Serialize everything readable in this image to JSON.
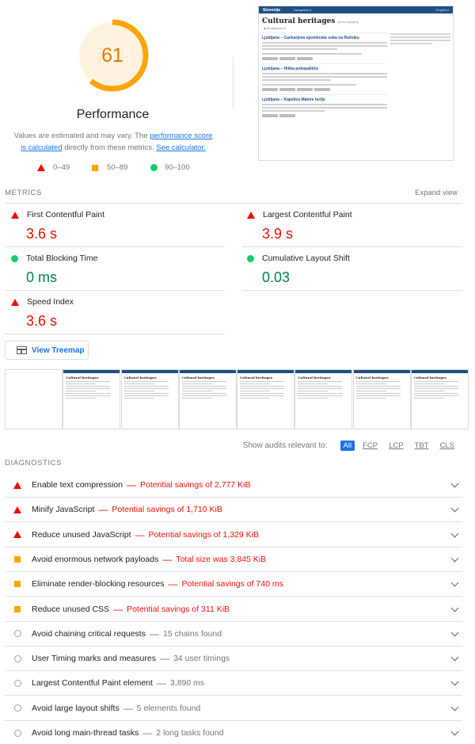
{
  "score": {
    "value": "61",
    "percent": 61,
    "color": "#ffa400"
  },
  "category_title": "Performance",
  "note": {
    "prefix": "Values are estimated and may vary. The ",
    "link1": "performance score is calculated",
    "middle": " directly from these metrics. ",
    "link2": "See calculator."
  },
  "legend": [
    {
      "range": "0–49",
      "icon": "triangle-icon",
      "color": "#eb0f00"
    },
    {
      "range": "50–89",
      "icon": "square-icon",
      "color": "#ffa400"
    },
    {
      "range": "90–100",
      "icon": "circle-icon",
      "color": "#0cce6b"
    }
  ],
  "screenshot": {
    "site_logo": "Slovenija",
    "nav_text": "Navigation ▾",
    "lang": "English ▾",
    "title": "Cultural heritages",
    "title_note": "(some highlights)",
    "subtitle": "◉ All categories ▾",
    "cards": [
      "Ljubljana – Cankarjeva spominska soba na Rožniku",
      "Ljubljana – Hiška pokopališče",
      "Ljubljana – Kapelica Matere božje"
    ]
  },
  "metrics_label": "METRICS",
  "expand_label": "Expand view",
  "metrics": [
    {
      "name": "First Contentful Paint",
      "value": "3.6 s",
      "rating": "fail"
    },
    {
      "name": "Largest Contentful Paint",
      "value": "3.9 s",
      "rating": "fail"
    },
    {
      "name": "Total Blocking Time",
      "value": "0 ms",
      "rating": "pass"
    },
    {
      "name": "Cumulative Layout Shift",
      "value": "0.03",
      "rating": "pass"
    },
    {
      "name": "Speed Index",
      "value": "3.6 s",
      "rating": "fail"
    }
  ],
  "treemap_button": "View Treemap",
  "filter": {
    "label": "Show audits relevant to:",
    "chips": [
      "All",
      "FCP",
      "LCP",
      "TBT",
      "CLS"
    ]
  },
  "diagnostics_label": "DIAGNOSTICS",
  "audits": [
    {
      "title": "Enable text compression",
      "detail": "Potential savings of 2,777 KiB",
      "rating": "fail"
    },
    {
      "title": "Minify JavaScript",
      "detail": "Potential savings of 1,710 KiB",
      "rating": "fail"
    },
    {
      "title": "Reduce unused JavaScript",
      "detail": "Potential savings of 1,329 KiB",
      "rating": "fail"
    },
    {
      "title": "Avoid enormous network payloads",
      "detail": "Total size was 3,845 KiB",
      "rating": "average"
    },
    {
      "title": "Eliminate render-blocking resources",
      "detail": "Potential savings of 740 ms",
      "rating": "average"
    },
    {
      "title": "Reduce unused CSS",
      "detail": "Potential savings of 311 KiB",
      "rating": "average"
    },
    {
      "title": "Avoid chaining critical requests",
      "detail": "15 chains found",
      "rating": "info"
    },
    {
      "title": "User Timing marks and measures",
      "detail": "34 user timings",
      "rating": "info"
    },
    {
      "title": "Largest Contentful Paint element",
      "detail": "3,890 ms",
      "rating": "info"
    },
    {
      "title": "Avoid large layout shifts",
      "detail": "5 elements found",
      "rating": "info"
    },
    {
      "title": "Avoid long main-thread tasks",
      "detail": "2 long tasks found",
      "rating": "info"
    }
  ]
}
